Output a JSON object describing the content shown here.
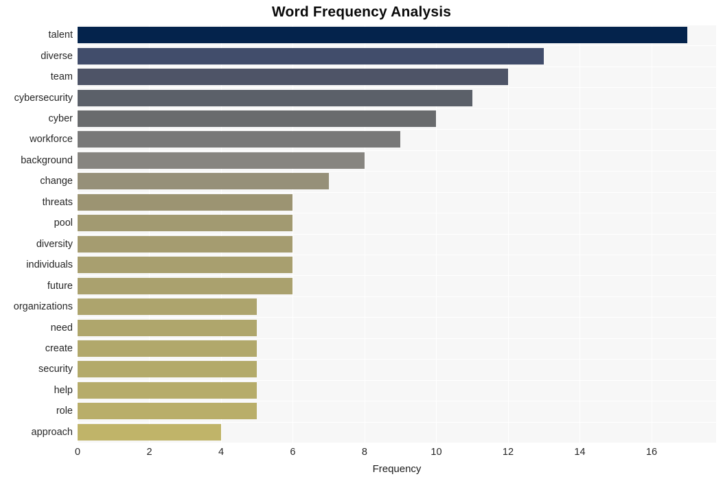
{
  "chart_data": {
    "type": "bar",
    "orientation": "horizontal",
    "title": "Word Frequency Analysis",
    "xlabel": "Frequency",
    "ylabel": "",
    "xlim": [
      0,
      17.8
    ],
    "ylim": [
      0,
      20
    ],
    "grid": true,
    "legend": null,
    "xticks": [
      0,
      2,
      4,
      6,
      8,
      10,
      12,
      14,
      16
    ],
    "xticklabels": [
      "0",
      "2",
      "4",
      "6",
      "8",
      "10",
      "12",
      "14",
      "16"
    ],
    "categories": [
      "talent",
      "diverse",
      "team",
      "cybersecurity",
      "cyber",
      "workforce",
      "background",
      "change",
      "threats",
      "pool",
      "diversity",
      "individuals",
      "future",
      "organizations",
      "need",
      "create",
      "security",
      "help",
      "role",
      "approach"
    ],
    "values": [
      17,
      13,
      12,
      11,
      10,
      9,
      8,
      7,
      6,
      6,
      6,
      6,
      6,
      5,
      5,
      5,
      5,
      5,
      5,
      4
    ],
    "bar_colors": [
      "#04234c",
      "#414d6b",
      "#4e5467",
      "#5b6069",
      "#696b6d",
      "#787878",
      "#878580",
      "#969079",
      "#9c9472",
      "#a29a71",
      "#a59c70",
      "#a89f6f",
      "#aaa16e",
      "#ada46d",
      "#afa66c",
      "#b1a86b",
      "#b3aa6a",
      "#b6ac6a",
      "#b9ae69",
      "#c0b469"
    ]
  },
  "style": {
    "plot_background": "#f7f7f7",
    "page_background": "#ffffff",
    "grid_color": "#ffffff",
    "tick_label_color": "#262626",
    "title_color": "#0a0a0a"
  }
}
